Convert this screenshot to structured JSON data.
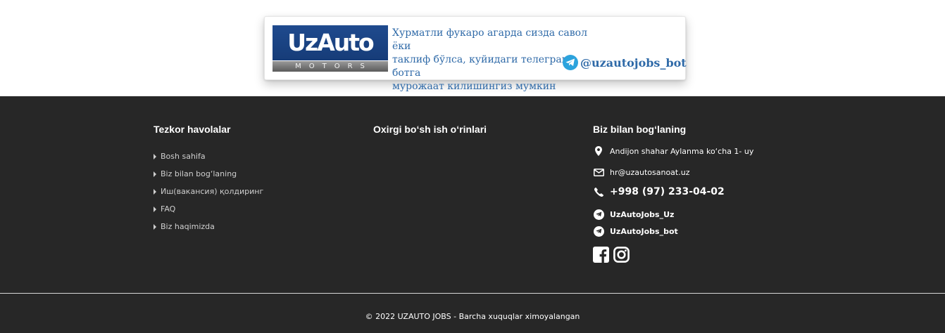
{
  "banner": {
    "logo_main": "UzAuto",
    "logo_sub": "MOTORS",
    "message_lines": [
      "Хурматли фукаро агарда сизда савол ёки",
      "таклиф бўлса, куйидаги телеграм ботга",
      "мурожаат килишингиз мумкин"
    ],
    "telegram_handle": "@uzautojobs_bot"
  },
  "footer": {
    "quick_links": {
      "title": "Tezkor havolalar",
      "items": [
        "Bosh sahifa",
        "Biz bilan bog‘laning",
        "Иш(вакансия) қолдиринг",
        "FAQ",
        "Biz haqimizda"
      ]
    },
    "latest_jobs": {
      "title": "Oxirgi bo‘sh ish o‘rinlari"
    },
    "contact": {
      "title": "Biz bilan bog‘laning",
      "address": "Andijon shahar Aylanma ko‘cha 1- uy",
      "email": "hr@uzautosanoat.uz",
      "phone": "+998 (97) 233-04-02",
      "telegram_channel": "UzAutoJobs_Uz",
      "telegram_bot": "UzAutoJobs_bot"
    },
    "copyright": "© 2022 UZAUTO JOBS - Barcha xuquqlar ximoyalangan"
  },
  "colors": {
    "footer_bg": "#272727",
    "banner_text": "#2f6aa8",
    "telegram_blue": "#2ca3dd",
    "logo_blue": "#1f4a8e"
  },
  "icons": [
    "map-marker-icon",
    "envelope-icon",
    "phone-icon",
    "telegram-icon",
    "facebook-icon",
    "instagram-icon",
    "caret-right-icon"
  ]
}
